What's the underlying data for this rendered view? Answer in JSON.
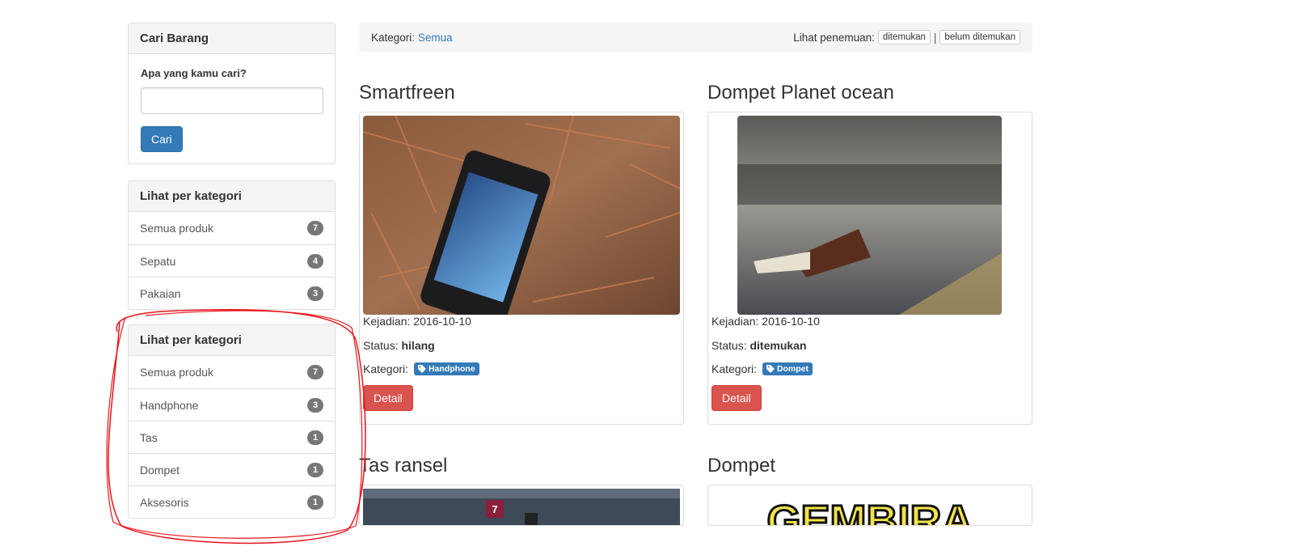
{
  "search": {
    "panel_title": "Cari Barang",
    "label": "Apa yang kamu cari?",
    "input_value": "",
    "button_label": "Cari"
  },
  "category_panels": [
    {
      "title": "Lihat per kategori",
      "items": [
        {
          "label": "Semua produk",
          "count": "7"
        },
        {
          "label": "Sepatu",
          "count": "4"
        },
        {
          "label": "Pakaian",
          "count": "3"
        }
      ]
    },
    {
      "title": "Lihat per kategori",
      "items": [
        {
          "label": "Semua produk",
          "count": "7"
        },
        {
          "label": "Handphone",
          "count": "3"
        },
        {
          "label": "Tas",
          "count": "1"
        },
        {
          "label": "Dompet",
          "count": "1"
        },
        {
          "label": "Aksesoris",
          "count": "1"
        }
      ]
    }
  ],
  "filter_bar": {
    "category_prefix": "Kategori:",
    "category_value": "Semua",
    "view_label": "Lihat penemuan:",
    "found_button": "ditemukan",
    "separator": "|",
    "not_found_button": "belum ditemukan"
  },
  "products": [
    {
      "title": "Smartfreen",
      "date_label": "Kejadian:",
      "date": "2016-10-10",
      "status_label": "Status:",
      "status": "hilang",
      "category_label": "Kategori:",
      "category": "Handphone",
      "button": "Detail"
    },
    {
      "title": "Dompet Planet ocean",
      "date_label": "Kejadian:",
      "date": "2016-10-10",
      "status_label": "Status:",
      "status": "ditemukan",
      "category_label": "Kategori:",
      "category": "Dompet",
      "button": "Detail"
    },
    {
      "title": "Tas ransel"
    },
    {
      "title": "Dompet"
    }
  ],
  "icons": {
    "tag": "tag-icon"
  },
  "colors": {
    "primary": "#337ab7",
    "danger": "#d9534f",
    "badge": "#777777",
    "annotation": "#e8141b",
    "thumb_text": "GEMBIRA"
  }
}
